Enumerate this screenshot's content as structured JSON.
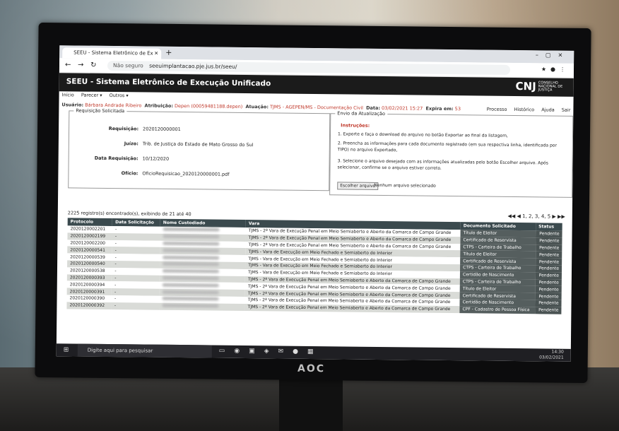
{
  "monitor": {
    "brand": "AOC"
  },
  "browser": {
    "tab_title": "SEEU - Sistema Eletrônico de Ex",
    "new_tab": "+",
    "not_secure": "Não seguro",
    "url": "seeuimplantacao.pje.jus.br/seeu/"
  },
  "app": {
    "title": "SEEU - Sistema Eletrônico de Execução Unificado",
    "logo": "CNJ",
    "logo_sub": "CONSELHO NACIONAL DE JUSTIÇA",
    "menu": [
      "Início",
      "Parecer ▾",
      "Outros ▾"
    ],
    "user_label": "Usuário:",
    "user_value": "Bárbara Andrade Ribeiro",
    "attr_label": "Atribuição:",
    "attr_value": "Depen (00059481188.depen)",
    "atuacao_label": "Atuação:",
    "atuacao_value": "TJMS - AGEPEN/MS - Documentação Civil",
    "data_label": "Data:",
    "data_value": "03/02/2021 15:27",
    "expira_label": "Expira em:",
    "expira_value": "53",
    "tools": [
      "Processo",
      "Histórico",
      "Ajuda",
      "Sair"
    ]
  },
  "requisicao": {
    "legend": "Requisição Solicitada",
    "fields": [
      {
        "label": "Requisição:",
        "value": "2020120000001"
      },
      {
        "label": "Juízo:",
        "value": "Trib. de Justiça do Estado de Mato Grosso do Sul"
      },
      {
        "label": "Data Requisição:",
        "value": "10/12/2020"
      },
      {
        "label": "Ofício:",
        "value": "OficioRequisicao_2020120000001.pdf"
      }
    ]
  },
  "envio": {
    "legend": "Envio da Atualização",
    "instr_title": "Instruções:",
    "steps": [
      "1. Exporte e faça o download do arquivo no botão Exportar ao final da listagem,",
      "2. Preencha as informações para cada documento registrado (em sua respectiva linha, identificada por TIPO) no arquivo Exportado,",
      "3. Selecione o arquivo desejado com as informações atualizadas pelo botão Escolher arquivo. Após selecionar, confirme se o arquivo estiver correto."
    ],
    "file_button": "Escolher arquivo",
    "no_file": "Nenhum arquivo selecionado"
  },
  "listing": {
    "count_text": "2225 registro(s) encontrado(s), exibindo de 21 até 40",
    "pager": "◀◀ ◀ 1, 2, 3, 4, 5 ▶ ▶▶",
    "headers": [
      "Protocolo",
      "Data Solicitação",
      "Nome Custodiado",
      "Vara",
      "Documento Solicitado",
      "Status"
    ],
    "rows": [
      {
        "protocolo": "2020120002201",
        "data": "-",
        "vara": "TJMS - 2ª Vara de Execução Penal em Meio Semiaberto e Aberto da Comarca de Campo Grande",
        "doc": "Título de Eleitor",
        "status": "Pendente"
      },
      {
        "protocolo": "2020120002199",
        "data": "-",
        "vara": "TJMS - 2ª Vara de Execução Penal em Meio Semiaberto e Aberto da Comarca de Campo Grande",
        "doc": "Certificado de Reservista",
        "status": "Pendente"
      },
      {
        "protocolo": "2020120002200",
        "data": "-",
        "vara": "TJMS - 2ª Vara de Execução Penal em Meio Semiaberto e Aberto da Comarca de Campo Grande",
        "doc": "CTPS - Carteira de Trabalho",
        "status": "Pendente"
      },
      {
        "protocolo": "2020120000541",
        "data": "-",
        "vara": "TJMS - Vara de Execução em Meio Fechado e Semiaberto do Interior",
        "doc": "Título de Eleitor",
        "status": "Pendente"
      },
      {
        "protocolo": "2020120000539",
        "data": "-",
        "vara": "TJMS - Vara de Execução em Meio Fechado e Semiaberto do Interior",
        "doc": "Certificado de Reservista",
        "status": "Pendente"
      },
      {
        "protocolo": "2020120000540",
        "data": "-",
        "vara": "TJMS - Vara de Execução em Meio Fechado e Semiaberto do Interior",
        "doc": "CTPS - Carteira de Trabalho",
        "status": "Pendente"
      },
      {
        "protocolo": "2020120000538",
        "data": "-",
        "vara": "TJMS - Vara de Execução em Meio Fechado e Semiaberto do Interior",
        "doc": "Certidão de Nascimento",
        "status": "Pendente"
      },
      {
        "protocolo": "2020120000393",
        "data": "-",
        "vara": "TJMS - 2ª Vara de Execução Penal em Meio Semiaberto e Aberto da Comarca de Campo Grande",
        "doc": "CTPS - Carteira de Trabalho",
        "status": "Pendente"
      },
      {
        "protocolo": "2020120000394",
        "data": "-",
        "vara": "TJMS - 2ª Vara de Execução Penal em Meio Semiaberto e Aberto da Comarca de Campo Grande",
        "doc": "Título de Eleitor",
        "status": "Pendente"
      },
      {
        "protocolo": "2020120000391",
        "data": "-",
        "vara": "TJMS - 2ª Vara de Execução Penal em Meio Semiaberto e Aberto da Comarca de Campo Grande",
        "doc": "Certificado de Reservista",
        "status": "Pendente"
      },
      {
        "protocolo": "2020120000390",
        "data": "-",
        "vara": "TJMS - 2ª Vara de Execução Penal em Meio Semiaberto e Aberto da Comarca de Campo Grande",
        "doc": "Certidão de Nascimento",
        "status": "Pendente"
      },
      {
        "protocolo": "2020120000392",
        "data": "-",
        "vara": "TJMS - 2ª Vara de Execução Penal em Meio Semiaberto e Aberto da Comarca de Campo Grande",
        "doc": "CPF - Cadastro de Pessoa Física",
        "status": "Pendente"
      }
    ]
  },
  "taskbar": {
    "search_placeholder": "Digite aqui para pesquisar",
    "time": "14:30",
    "date": "03/02/2021"
  }
}
